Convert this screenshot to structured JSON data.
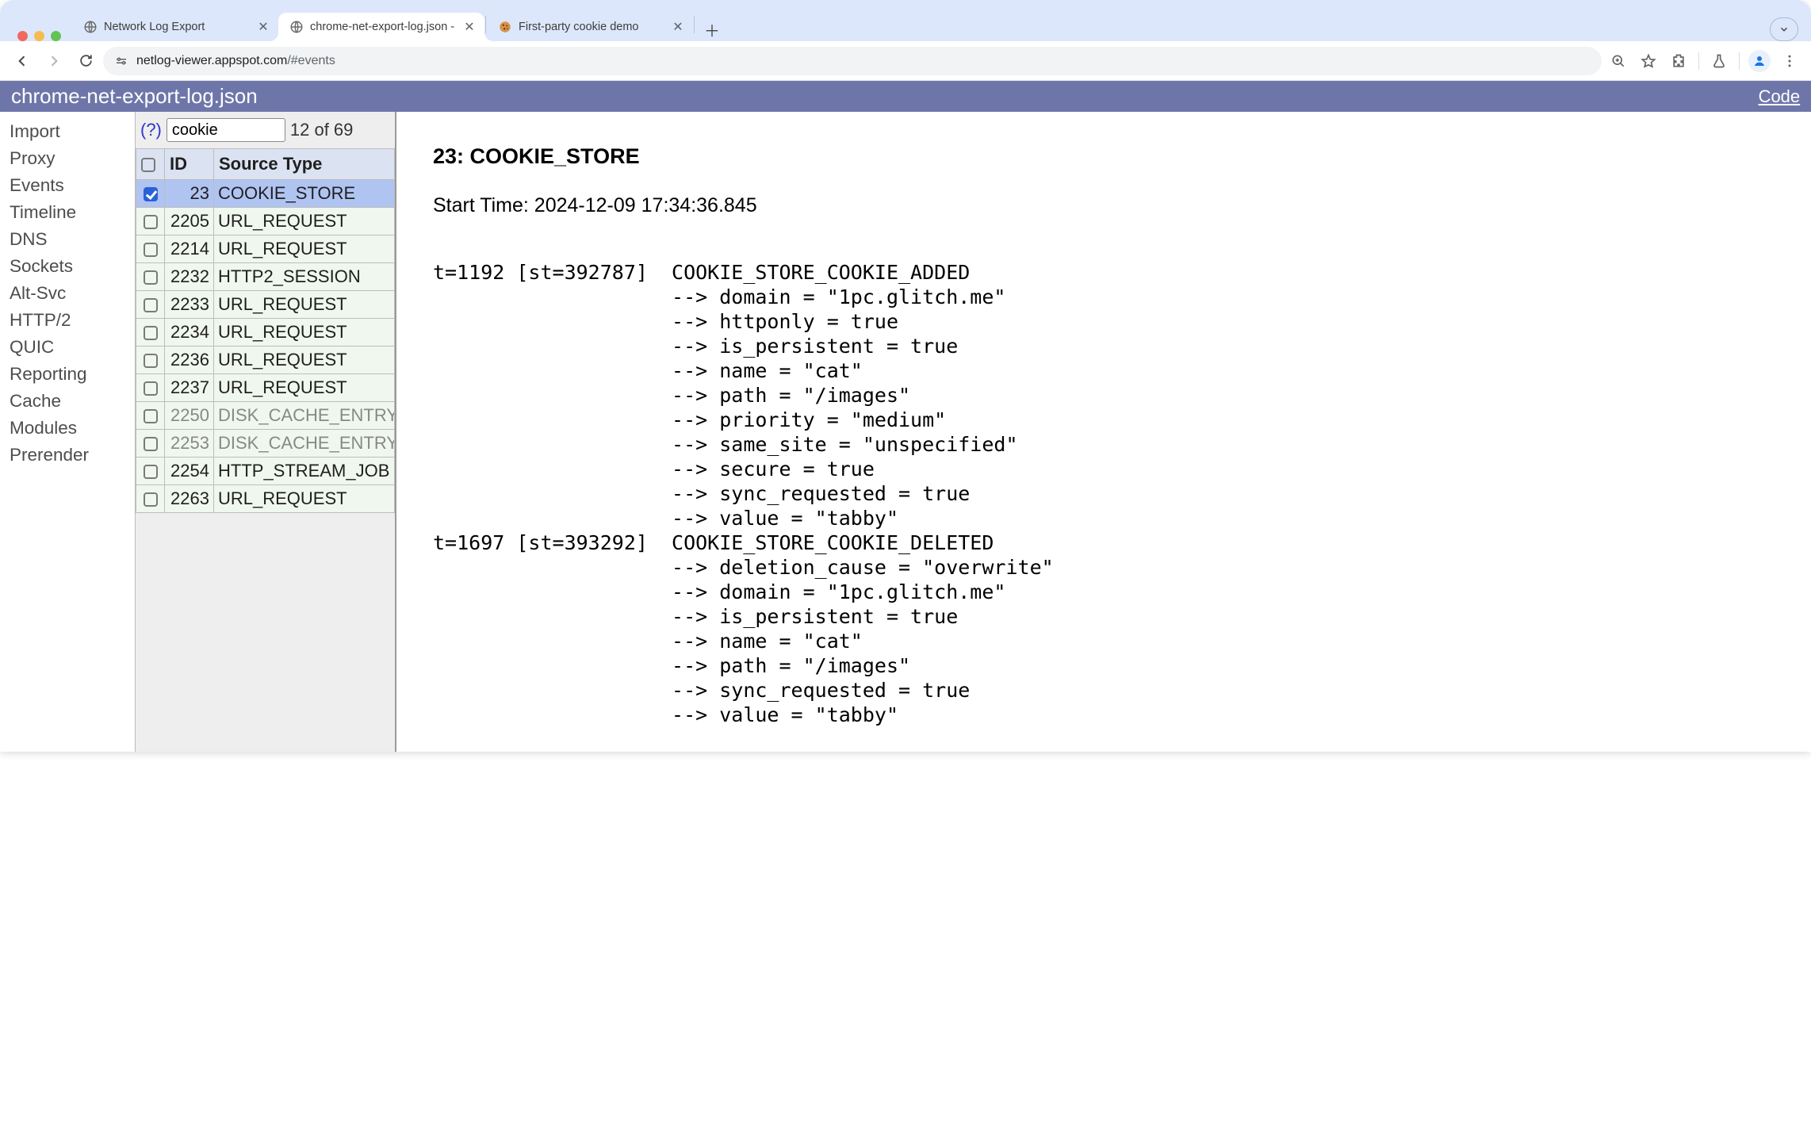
{
  "browser": {
    "tabs": [
      {
        "favicon": "globe",
        "title": "Network Log Export",
        "active": false
      },
      {
        "favicon": "globe",
        "title": "chrome-net-export-log.json - ",
        "active": true
      },
      {
        "favicon": "cookie",
        "title": "First-party cookie demo",
        "active": false
      }
    ],
    "url_host": "netlog-viewer.appspot.com",
    "url_path": "/#events"
  },
  "header": {
    "filename": "chrome-net-export-log.json",
    "code_link": "Code"
  },
  "sidebar": {
    "items": [
      "Import",
      "Proxy",
      "Events",
      "Timeline",
      "DNS",
      "Sockets",
      "Alt-Svc",
      "HTTP/2",
      "QUIC",
      "Reporting",
      "Cache",
      "Modules",
      "Prerender"
    ]
  },
  "filter": {
    "help": "(?)",
    "value": "cookie",
    "count": "12 of 69"
  },
  "columns": {
    "id": "ID",
    "source": "Source Type"
  },
  "rows": [
    {
      "id": "23",
      "type": "COOKIE_STORE",
      "selected": true,
      "dim": false
    },
    {
      "id": "2205",
      "type": "URL_REQUEST",
      "selected": false,
      "dim": false
    },
    {
      "id": "2214",
      "type": "URL_REQUEST",
      "selected": false,
      "dim": false
    },
    {
      "id": "2232",
      "type": "HTTP2_SESSION",
      "selected": false,
      "dim": false
    },
    {
      "id": "2233",
      "type": "URL_REQUEST",
      "selected": false,
      "dim": false
    },
    {
      "id": "2234",
      "type": "URL_REQUEST",
      "selected": false,
      "dim": false
    },
    {
      "id": "2236",
      "type": "URL_REQUEST",
      "selected": false,
      "dim": false
    },
    {
      "id": "2237",
      "type": "URL_REQUEST",
      "selected": false,
      "dim": false
    },
    {
      "id": "2250",
      "type": "DISK_CACHE_ENTRY",
      "selected": false,
      "dim": true
    },
    {
      "id": "2253",
      "type": "DISK_CACHE_ENTRY",
      "selected": false,
      "dim": true
    },
    {
      "id": "2254",
      "type": "HTTP_STREAM_JOB",
      "selected": false,
      "dim": false
    },
    {
      "id": "2263",
      "type": "URL_REQUEST",
      "selected": false,
      "dim": false
    }
  ],
  "detail": {
    "title": "23: COOKIE_STORE",
    "start": "Start Time: 2024-12-09 17:34:36.845",
    "body": "t=1192 [st=392787]  COOKIE_STORE_COOKIE_ADDED\n                    --> domain = \"1pc.glitch.me\"\n                    --> httponly = true\n                    --> is_persistent = true\n                    --> name = \"cat\"\n                    --> path = \"/images\"\n                    --> priority = \"medium\"\n                    --> same_site = \"unspecified\"\n                    --> secure = true\n                    --> sync_requested = true\n                    --> value = \"tabby\"\nt=1697 [st=393292]  COOKIE_STORE_COOKIE_DELETED\n                    --> deletion_cause = \"overwrite\"\n                    --> domain = \"1pc.glitch.me\"\n                    --> is_persistent = true\n                    --> name = \"cat\"\n                    --> path = \"/images\"\n                    --> sync_requested = true\n                    --> value = \"tabby\""
  }
}
